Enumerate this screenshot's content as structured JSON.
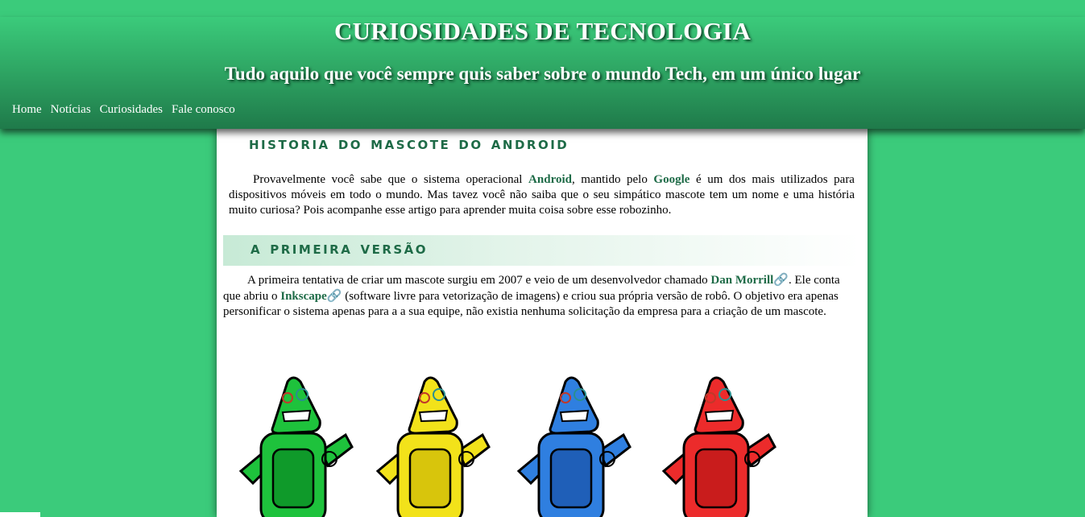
{
  "header": {
    "title": "CURIOSIDADES DE TECNOLOGIA",
    "subtitle": "Tudo aquilo que você sempre quis saber sobre o mundo Tech, em um único lugar"
  },
  "nav": {
    "items": [
      {
        "label": "Home"
      },
      {
        "label": "Notícias"
      },
      {
        "label": "Curiosidades"
      },
      {
        "label": "Fale conosco"
      }
    ]
  },
  "article": {
    "title": "Historia do mascote do android",
    "intro": {
      "p1": "Provavelmente você sabe que o sistema operacional ",
      "android": "Android",
      "p2": ", mantido pelo ",
      "google": "Google",
      "p3": " é um dos mais utilizados para dispositivos móveis em todo o mundo. Mas tavez você não saiba que o seu simpático mascote tem um nome e uma história muito curiosa? Pois acompanhe esse artigo para aprender muita coisa sobre esse robozinho."
    },
    "section": {
      "title": "a primeira versão",
      "t1": "A primeira tentativa de criar um mascote surgiu em 2007 e veio de um desenvolvedor chamado ",
      "link1": "Dan Morrill",
      "t2": ". Ele conta que abriu o ",
      "link2": "Inkscape",
      "t3": " (software livre para vetorização de imagens) e criou sua própria versão de robô. O objetivo era apenas personificar o sistema apenas para a a sua equipe, não existia nenhuma solicitação da empresa para a criação de um mascote."
    },
    "robots": [
      {
        "color": "#1ec23c",
        "dark": "#0f9a2a",
        "name": "green-robot"
      },
      {
        "color": "#f2e21a",
        "dark": "#d8c50c",
        "name": "yellow-robot"
      },
      {
        "color": "#2f7fe0",
        "dark": "#1f5fb8",
        "name": "blue-robot"
      },
      {
        "color": "#ec2b2b",
        "dark": "#c91c1c",
        "name": "red-robot"
      }
    ]
  },
  "theme": {
    "background": "#3bcb7b",
    "accent": "#1e6b47"
  },
  "icons": {
    "link": "paperclip-icon"
  }
}
